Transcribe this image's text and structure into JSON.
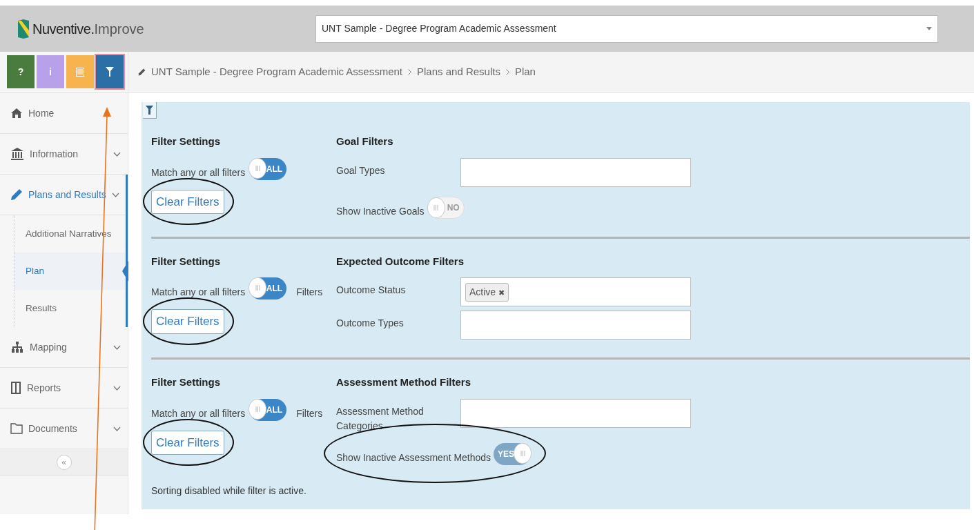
{
  "header": {
    "brand": "Nuventive.",
    "product": "Improve",
    "program_select": {
      "value": "UNT Sample - Degree Program Academic Assessment"
    }
  },
  "toolbar": [
    {
      "kind": "help",
      "label": "?",
      "color": "#4a7c3f",
      "selected": false
    },
    {
      "kind": "info",
      "label": "i",
      "color": "#b9a0ea",
      "selected": false
    },
    {
      "kind": "notes",
      "color": "#f7b34e",
      "selected": false
    },
    {
      "kind": "filter",
      "color": "#2c6fa6",
      "selected": true
    }
  ],
  "nav": [
    {
      "label": "Home",
      "expandable": false,
      "selected": false
    },
    {
      "label": "Information",
      "expandable": true,
      "selected": false
    },
    {
      "label": "Plans and Results",
      "expandable": true,
      "selected": true,
      "children": [
        {
          "label": "Additional Narratives",
          "selected": false
        },
        {
          "label": "Plan",
          "selected": true
        },
        {
          "label": "Results",
          "selected": false
        }
      ]
    },
    {
      "label": "Mapping",
      "expandable": true,
      "selected": false
    },
    {
      "label": "Reports",
      "expandable": true,
      "selected": false
    },
    {
      "label": "Documents",
      "expandable": true,
      "selected": false
    }
  ],
  "collapse": "«",
  "breadcrumb": [
    "UNT Sample - Degree Program Academic Assessment",
    "Plans and Results",
    "Plan"
  ],
  "filter_sections": [
    {
      "settings_title": "Filter Settings",
      "match_label": "Match any or all filters",
      "match_toggle": {
        "label": "ALL",
        "on": true
      },
      "clear_button": {
        "label": "Clear Filters",
        "circled": true
      },
      "title": "Goal Filters",
      "rows": [
        {
          "kind": "field",
          "label": "Goal Types"
        },
        {
          "kind": "toggle",
          "label": "Show Inactive Goals",
          "toggle": {
            "label": "NO",
            "on": false
          },
          "circled": false
        }
      ]
    },
    {
      "settings_title": "Filter Settings",
      "match_label": "Match any or all filters",
      "match_toggle": {
        "label": "ALL",
        "on": true
      },
      "suffix": "Filters",
      "clear_button": {
        "label": "Clear Filters",
        "circled": true
      },
      "title": "Expected Outcome Filters",
      "rows": [
        {
          "kind": "field",
          "label": "Outcome Status",
          "tags": [
            {
              "label": "Active",
              "remove": "✖"
            }
          ]
        },
        {
          "kind": "field",
          "label": "Outcome Types"
        }
      ]
    },
    {
      "settings_title": "Filter Settings",
      "match_label": "Match any or all filters",
      "match_toggle": {
        "label": "ALL",
        "on": true
      },
      "suffix": "Filters",
      "clear_button": {
        "label": "Clear Filters",
        "circled": true
      },
      "title": "Assessment Method Filters",
      "rows": [
        {
          "kind": "field",
          "label": "Assessment Method Categories"
        },
        {
          "kind": "toggle",
          "label": "Show Inactive Assessment Methods",
          "toggle": {
            "label": "YES",
            "on": true
          },
          "circled": true
        }
      ]
    }
  ],
  "note": "Sorting disabled while filter is active."
}
